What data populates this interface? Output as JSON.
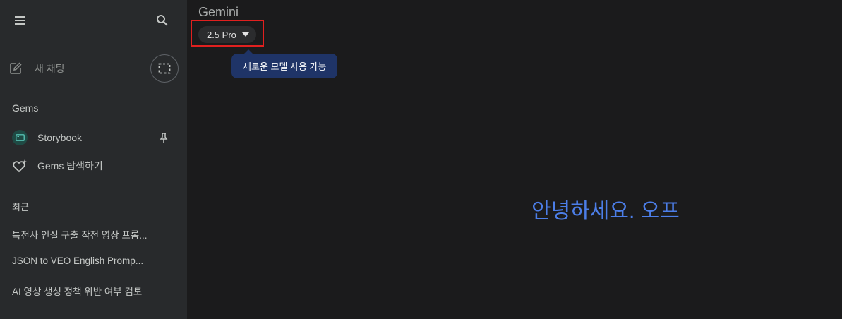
{
  "sidebar": {
    "new_chat_label": "새 채팅",
    "gems_title": "Gems",
    "gems": [
      {
        "label": "Storybook",
        "icon": "book-icon",
        "pinned": true
      },
      {
        "label": "Gems 탐색하기",
        "icon": "gem-sparkle-icon"
      }
    ],
    "recent_title": "최근",
    "recent": [
      {
        "label": "특전사 인질 구출 작전 영상 프롬..."
      },
      {
        "label": "JSON to VEO English Promp..."
      },
      {
        "label": "AI 영상 생성 정책 위반 여부 검토"
      }
    ]
  },
  "header": {
    "brand": "Gemini",
    "model_label": "2.5 Pro",
    "tooltip": "새로운 모델 사용 가능"
  },
  "main": {
    "greeting": "안녕하세요. 오프"
  },
  "colors": {
    "sidebar_bg": "#282a2c",
    "main_bg": "#1b1b1c",
    "greeting": "#4c7ee8",
    "tooltip_bg": "#1f3467",
    "highlight": "#e1201f"
  }
}
